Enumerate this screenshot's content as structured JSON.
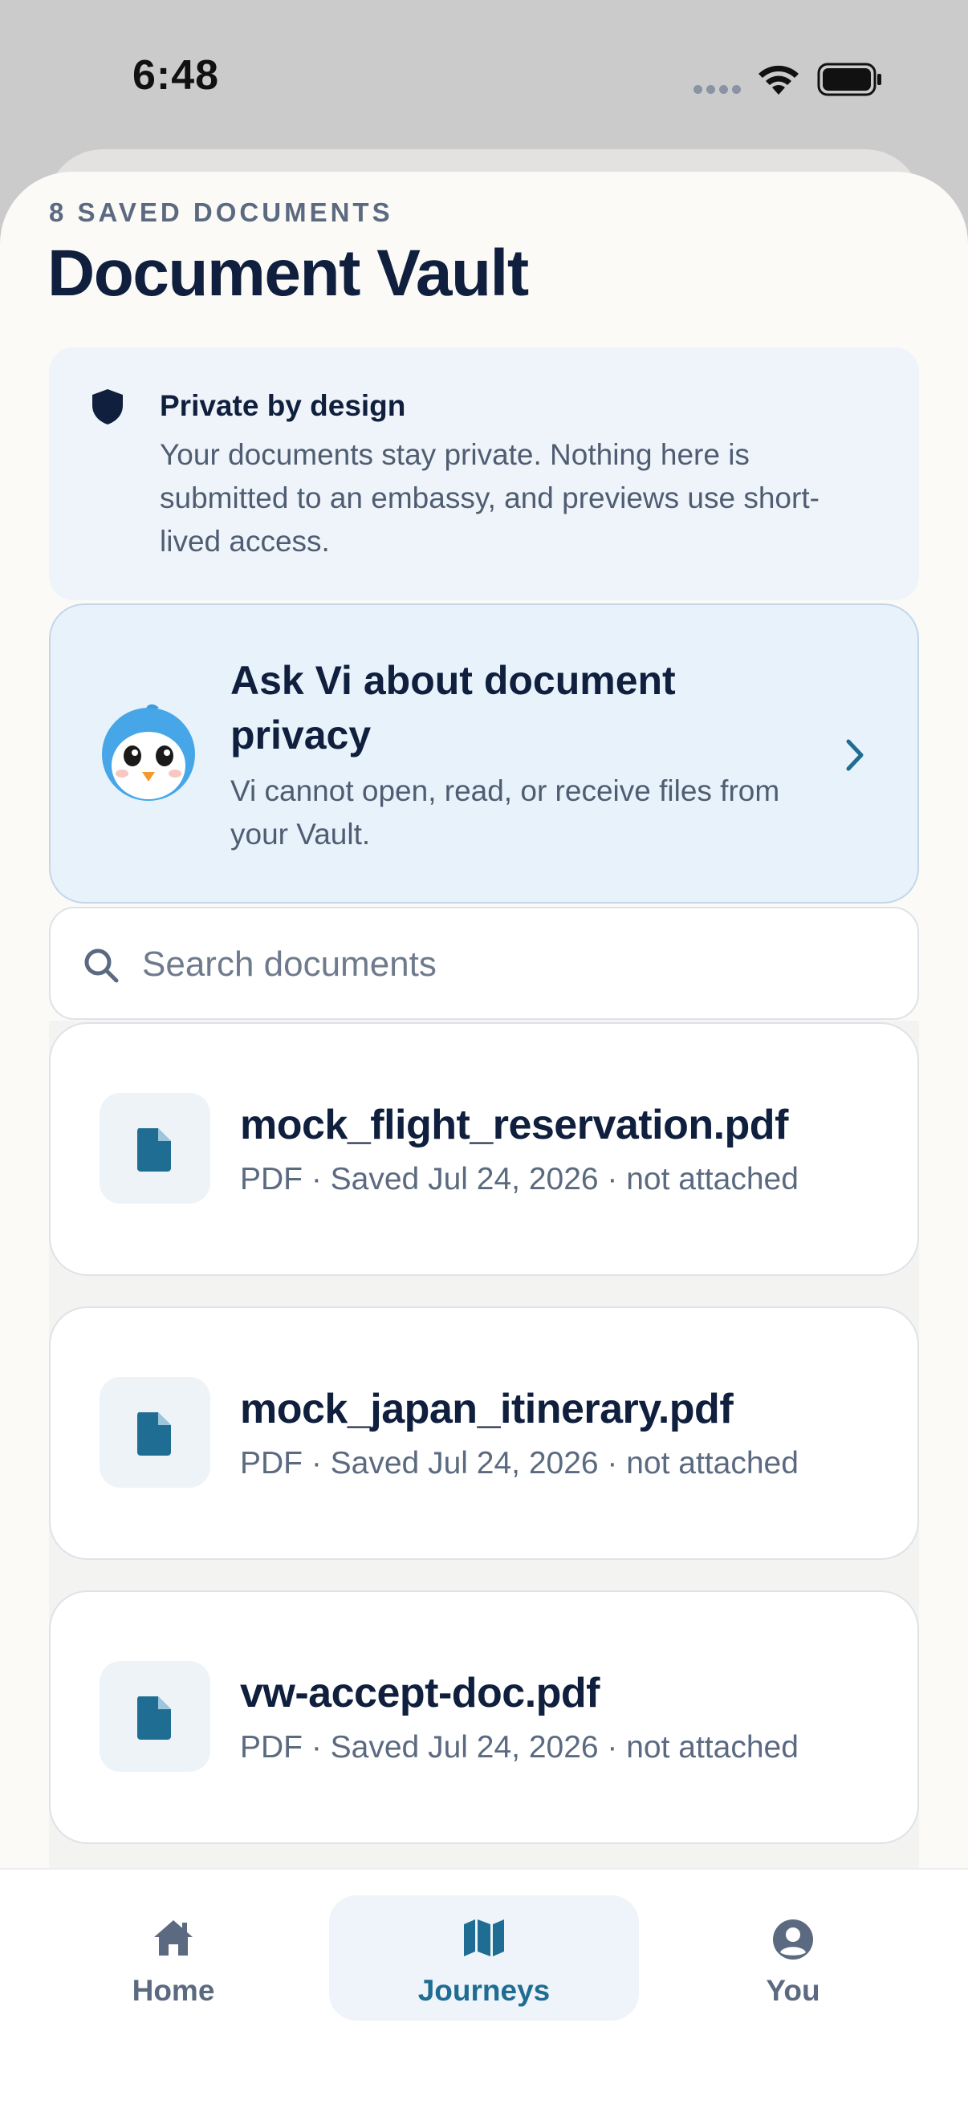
{
  "status_bar": {
    "time": "6:48"
  },
  "header": {
    "eyebrow": "8 SAVED DOCUMENTS",
    "title": "Document Vault"
  },
  "privacy_notice": {
    "icon": "shield-icon",
    "title": "Private by design",
    "text": "Your documents stay private. Nothing here is submitted to an embassy, and previews use short-lived access."
  },
  "ask_vi": {
    "avatar": "bird-avatar",
    "title": "Ask Vi about document privacy",
    "text": "Vi cannot open, read, or receive files from your Vault."
  },
  "search": {
    "placeholder": "Search documents",
    "value": ""
  },
  "documents": [
    {
      "name": "mock_flight_reservation.pdf",
      "meta": "PDF · Saved Jul 24, 2026 · not attached"
    },
    {
      "name": "mock_japan_itinerary.pdf",
      "meta": "PDF · Saved Jul 24, 2026 · not attached"
    },
    {
      "name": "vw-accept-doc.pdf",
      "meta": "PDF · Saved Jul 24, 2026 · not attached"
    }
  ],
  "tab_bar": {
    "active": "Journeys",
    "tabs": [
      {
        "label": "Home",
        "icon": "home-icon"
      },
      {
        "label": "Journeys",
        "icon": "map-icon"
      },
      {
        "label": "You",
        "icon": "profile-icon"
      }
    ]
  },
  "colors": {
    "primary_text": "#0f1f3d",
    "accent": "#1f6d93",
    "card_highlight": "#e8f2fb"
  }
}
